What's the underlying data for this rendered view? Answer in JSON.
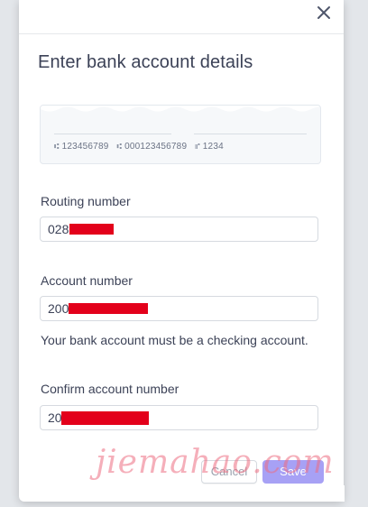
{
  "modal": {
    "title": "Enter bank account details",
    "close_icon": "close-icon"
  },
  "check_sample": {
    "routing_symbol": "⑆",
    "routing_example": "123456789",
    "account_symbol": "⑆",
    "account_example": "000123456789",
    "check_symbol": "⑈",
    "check_example": "1234"
  },
  "fields": {
    "routing": {
      "label": "Routing number",
      "value_visible": "028"
    },
    "account": {
      "label": "Account number",
      "value_visible": "200",
      "help_text": "Your bank account must be a checking account."
    },
    "confirm": {
      "label": "Confirm account number",
      "value_visible": "20"
    }
  },
  "footer": {
    "cancel_label": "Cancel",
    "save_label": "Save"
  },
  "watermark": {
    "text": "jiemahao.com"
  },
  "colors": {
    "accent_disabled": "#a7a1f5",
    "text": "#3c4257",
    "redaction": "#e3001b"
  }
}
